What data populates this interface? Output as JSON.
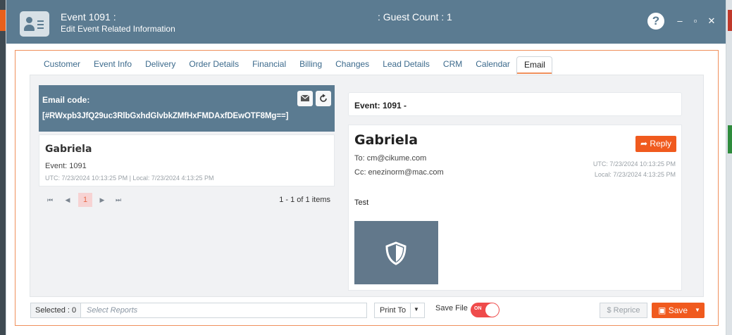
{
  "window": {
    "title": "Event 1091 :",
    "subtitle": "Edit Event Related Information",
    "guest_count": ": Guest Count : 1",
    "help_label": "?",
    "minimize_label": "–",
    "maximize_label": "▫",
    "close_label": "✕"
  },
  "tabs": [
    {
      "label": "Customer"
    },
    {
      "label": "Event Info"
    },
    {
      "label": "Delivery"
    },
    {
      "label": "Order Details"
    },
    {
      "label": "Financial"
    },
    {
      "label": "Billing"
    },
    {
      "label": "Changes"
    },
    {
      "label": "Lead Details"
    },
    {
      "label": "CRM"
    },
    {
      "label": "Calendar"
    },
    {
      "label": "Email",
      "active": true
    }
  ],
  "email_panel": {
    "code_label": "Email code:",
    "code_value": "[#RWxpb3JfQ29uc3RlbGxhdGlvbkZMfHxFMDAxfDEwOTF8Mg==]"
  },
  "list": {
    "items": [
      {
        "name": "Gabriela",
        "event": "Event: 1091",
        "time": "UTC: 7/23/2024 10:13:25 PM | Local: 7/23/2024 4:13:25 PM"
      }
    ],
    "pager": {
      "current_page": "1",
      "info": "1 - 1 of 1 items",
      "first": "⏮",
      "prev": "◀",
      "next": "▶",
      "last": "⏭"
    }
  },
  "message": {
    "header": "Event: 1091 -",
    "from_name": "Gabriela",
    "to": "To: cm@cikume.com",
    "cc": "Cc: enezinorm@mac.com",
    "reply_label": "➦ Reply",
    "utc": "UTC: 7/23/2024 10:13:25 PM",
    "local": "Local: 7/23/2024 4:13:25 PM",
    "body": "Test"
  },
  "footer": {
    "selected": "Selected : 0",
    "select_reports_placeholder": "Select Reports",
    "print_to": "Print To",
    "save_file_label": "Save File",
    "toggle_state": "ON",
    "reprice": "$ Reprice",
    "save": "Save"
  },
  "colors": {
    "titlebar": "#5b7b91",
    "accent": "#f05a1e",
    "toggle_on": "#ef4b4b"
  }
}
